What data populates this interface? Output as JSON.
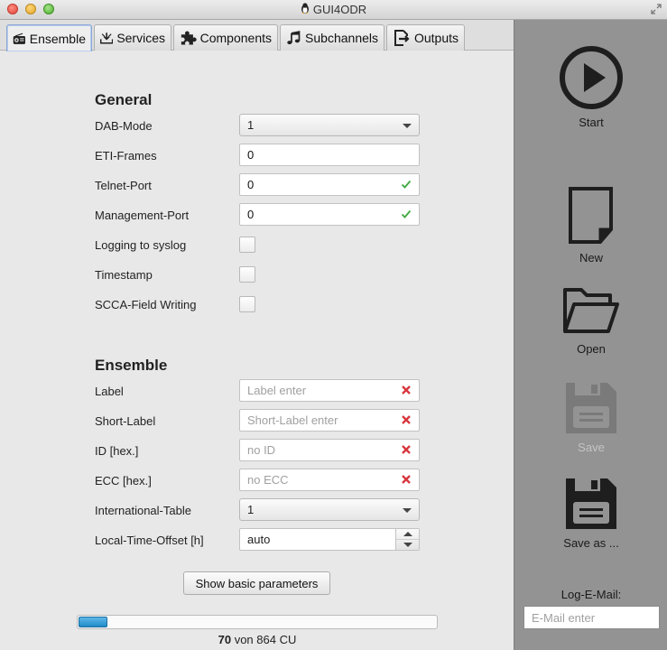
{
  "window": {
    "title": "GUI4ODR"
  },
  "tabs": [
    {
      "label": "Ensemble",
      "icon": "radio-icon",
      "active": true
    },
    {
      "label": "Services",
      "icon": "download-tray-icon",
      "active": false
    },
    {
      "label": "Components",
      "icon": "puzzle-icon",
      "active": false
    },
    {
      "label": "Subchannels",
      "icon": "music-note-icon",
      "active": false
    },
    {
      "label": "Outputs",
      "icon": "export-icon",
      "active": false
    }
  ],
  "general": {
    "title": "General",
    "dab_mode": {
      "label": "DAB-Mode",
      "value": "1"
    },
    "eti_frames": {
      "label": "ETI-Frames",
      "value": "0"
    },
    "telnet_port": {
      "label": "Telnet-Port",
      "value": "0",
      "valid": true
    },
    "management_port": {
      "label": "Management-Port",
      "value": "0",
      "valid": true
    },
    "logging_syslog": {
      "label": "Logging to syslog",
      "checked": false
    },
    "timestamp": {
      "label": "Timestamp",
      "checked": false
    },
    "scca_field": {
      "label": "SCCA-Field Writing",
      "checked": false
    }
  },
  "ensemble": {
    "title": "Ensemble",
    "label": {
      "label": "Label",
      "placeholder": "Label enter",
      "valid": false
    },
    "short_label": {
      "label": "Short-Label",
      "placeholder": "Short-Label enter",
      "valid": false
    },
    "id": {
      "label": "ID [hex.]",
      "placeholder": "no ID",
      "valid": false
    },
    "ecc": {
      "label": "ECC [hex.]",
      "placeholder": "no ECC",
      "valid": false
    },
    "international_table": {
      "label": "International-Table",
      "value": "1"
    },
    "local_time_offset": {
      "label": "Local-Time-Offset [h]",
      "value": "auto"
    }
  },
  "toggle_button": {
    "label": "Show basic parameters"
  },
  "capacity": {
    "used": "70",
    "separator": "von",
    "total": "864",
    "unit": "CU",
    "fraction": 0.081
  },
  "sidebar": {
    "start": {
      "label": "Start",
      "icon": "play-icon",
      "enabled": true
    },
    "new": {
      "label": "New",
      "icon": "new-document-icon",
      "enabled": true
    },
    "open": {
      "label": "Open",
      "icon": "folder-open-icon",
      "enabled": true
    },
    "save": {
      "label": "Save",
      "icon": "floppy-disk-icon",
      "enabled": false
    },
    "save_as": {
      "label": "Save as ...",
      "icon": "floppy-disk-icon",
      "enabled": true
    },
    "log_email": {
      "label": "Log-E-Mail:",
      "placeholder": "E-Mail enter"
    }
  },
  "colors": {
    "valid": "#3caa3c",
    "invalid": "#d9363e",
    "progress": "#1f8bc8",
    "sidebar": "#939393"
  }
}
